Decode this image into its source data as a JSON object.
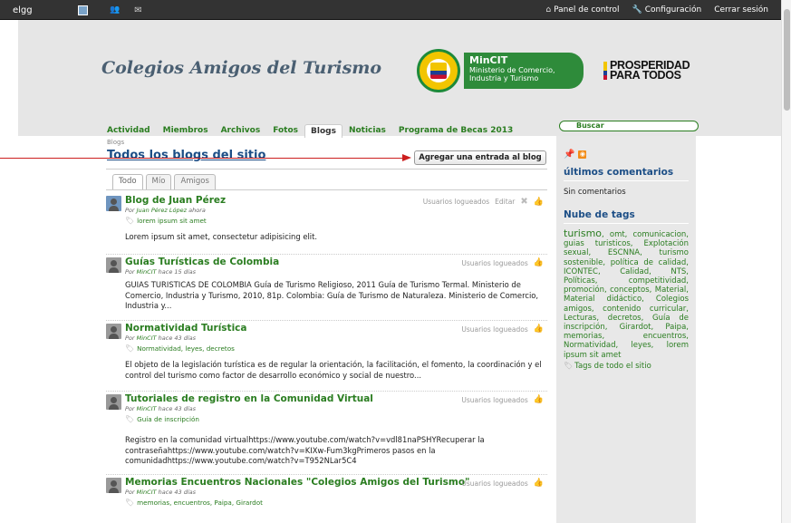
{
  "topbar": {
    "logo": "elgg",
    "friends_icon": "friends-icon",
    "mail_icon": "mail-icon",
    "right_links": [
      "Panel de control",
      "Configuración",
      "Cerrar sesión"
    ]
  },
  "header": {
    "site_title": "Colegios Amigos del Turismo",
    "mincit": {
      "name": "MinCIT",
      "sub1": "Ministerio de Comercio,",
      "sub2": "Industria y Turismo"
    },
    "prosperidad": {
      "line1": "PROSPERIDAD",
      "line2": "PARA TODOS"
    }
  },
  "nav": {
    "items": [
      "Actividad",
      "Miembros",
      "Archivos",
      "Fotos",
      "Blogs",
      "Noticias",
      "Programa de Becas 2013"
    ],
    "active": "Blogs"
  },
  "search": {
    "label": "Buscar"
  },
  "main": {
    "breadcrumb": "Blogs",
    "title": "Todos los blogs del sitio",
    "add_button": "Agregar una entrada al blog",
    "filters": [
      "Todo",
      "Mío",
      "Amigos"
    ]
  },
  "posts": [
    {
      "title": "Blog de Juan Pérez",
      "by_prefix": "Por ",
      "author": "Juan Pérez López",
      "when": " ahora",
      "access": "Usuarios logueados",
      "edit": "Editar",
      "tags": "lorem ipsum sit amet",
      "excerpt": "Lorem ipsum sit amet, consectetur adipisicing elit."
    },
    {
      "title": "Guías Turísticas de Colombia",
      "by_prefix": "Por ",
      "author": "MinCIT",
      "when": " hace 15 días",
      "access": "Usuarios logueados",
      "excerpt": "GUIAS TURISTICAS DE COLOMBIA Guía de Turismo Religioso, 2011 Guía de Turismo Termal. Ministerio de Comercio, Industria y Turismo, 2010, 81p. Colombia: Guía de Turismo de Naturaleza. Ministerio de Comercio, Industria y..."
    },
    {
      "title": "Normatividad Turística",
      "by_prefix": "Por ",
      "author": "MinCIT",
      "when": " hace 43 días",
      "access": "Usuarios logueados",
      "tags": "Normatividad, leyes, decretos",
      "excerpt": "El objeto de la legislación turística es de regular la orientación, la facilitación, el fomento, la coordinación y el control del turismo como factor de desarrollo económico y social de nuestro..."
    },
    {
      "title": "Tutoriales de registro en la Comunidad Virtual",
      "by_prefix": "Por ",
      "author": "MinCIT",
      "when": " hace 43 días",
      "access": "Usuarios logueados",
      "tags": "Guía de inscripción",
      "excerpt": "Registro en la comunidad virtualhttps://www.youtube.com/watch?v=vdl81naPSHYRecuperar la contraseñahttps://www.youtube.com/watch?v=KIXw-Fum3kgPrimeros pasos en la comunidadhttps://www.youtube.com/watch?v=T952NLar5C4"
    },
    {
      "title": "Memorias Encuentros Nacionales \"Colegios Amigos del Turismo\"",
      "by_prefix": "Por ",
      "author": "MinCIT",
      "when": " hace 43 días",
      "access": "Usuarios logueados",
      "tags": "memorias, encuentros, Paipa, Girardot"
    }
  ],
  "sidebar": {
    "comments_heading": "últimos comentarios",
    "comments_text": "Sin comentarios",
    "tags_heading": "Nube de tags",
    "tag_first": "turismo",
    "tags_rest": ", omt, comunicacion, guias turisticos, Explotación sexual, ESCNNA, turismo sostenible, política de calidad, ICONTEC, Calidad, NTS, Políticas, competitividad, promoción, conceptos, Material, Material didáctico, Colegios amigos, contenido curricular, Lecturas, decretos, Guía de inscripción, Girardot, Paipa, memorias, encuentros, Normatividad, leyes, lorem ipsum sit amet",
    "tags_all": "Tags de todo el sitio"
  },
  "colors": {
    "green": "#2a7d20",
    "blue_heading": "#1c4e86",
    "annotation_red": "#cc1f1f",
    "topbar": "#333333"
  }
}
